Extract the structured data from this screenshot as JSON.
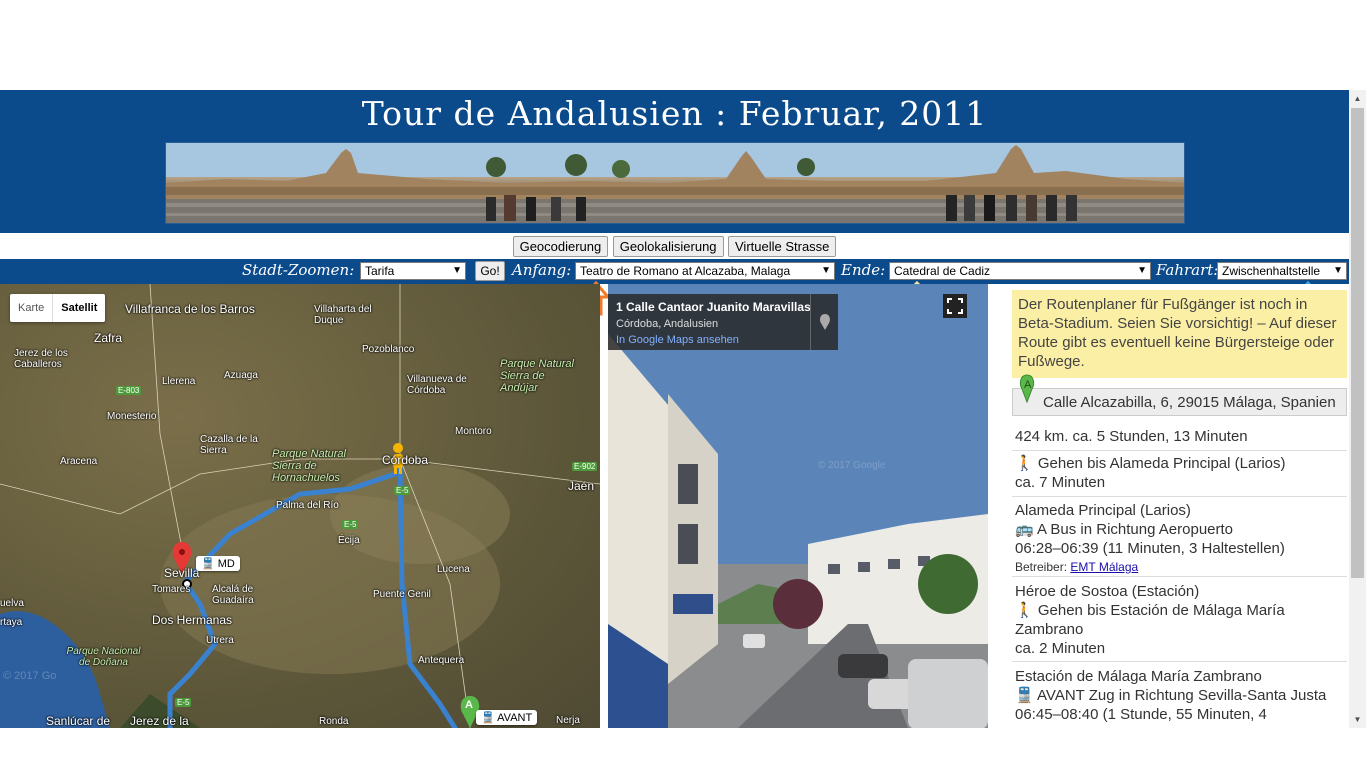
{
  "header": {
    "title": "Tour de Andalusien : Februar, 2011"
  },
  "toolbar": {
    "geocode_label": "Geocodierung",
    "geolocate_label": "Geolokalisierung",
    "virtual_street_label": "Virtuelle Strasse"
  },
  "controls": {
    "city_zoom_label": "Stadt-Zoomen:",
    "city_zoom_value": "Tarifa",
    "go_label": "Go!",
    "start_label": "Anfang:",
    "start_value": "Teatro de Romano at Alcazaba, Malaga",
    "end_label": "Ende:",
    "end_value": "Catedral de Cadiz",
    "travel_mode_label": "Fahrart:",
    "travel_mode_value": "Zwischenhaltstelle"
  },
  "map": {
    "type_map_label": "Karte",
    "type_satellite_label": "Satellit",
    "places": {
      "villafranca": "Villafranca de los Barros",
      "zafra": "Zafra",
      "jerez_caballeros": "Jerez de los Caballeros",
      "llerena": "Llerena",
      "azuaga": "Azuaga",
      "pozoblanco": "Pozoblanco",
      "villanueva": "Villanueva de Córdoba",
      "monesterio": "Monesterio",
      "cazalla": "Cazalla de la Sierra",
      "aracena": "Aracena",
      "montoro": "Montoro",
      "andujar_park": "Parque Natural Sierra de Andújar",
      "hornachuelos_park": "Parque Natural Sierra de Hornachuelos",
      "cordoba": "Córdoba",
      "jaen": "Jaén",
      "palma": "Palma del Río",
      "ecija": "Écija",
      "sevilla": "Sevilla",
      "tomares": "Tomares",
      "alcala": "Alcalá de Guadaíra",
      "dos_hermanas": "Dos Hermanas",
      "utrera": "Utrera",
      "lucena": "Lucena",
      "puente_genil": "Puente Genil",
      "antequera": "Antequera",
      "donana_park": "Parque Nacional de Doñana",
      "sanlucar": "Sanlúcar de",
      "jerez": "Jerez de la",
      "ronda": "Ronda",
      "nerja": "Nerja",
      "huelva": "uelva",
      "cartaya": "rtaya"
    },
    "roads": [
      "E-803",
      "E-5",
      "E-902",
      "E-5",
      "E-5"
    ],
    "transit_md": "MD",
    "transit_avant": "AVANT",
    "marker_a": "A",
    "watermark": "© 2017 Go"
  },
  "streetview": {
    "address": "1 Calle Cantaor Juanito Maravillas",
    "city": "Córdoba, Andalusien",
    "maps_link": "In Google Maps ansehen",
    "watermark": "© 2017 Google"
  },
  "directions": {
    "warning": "Der Routenplaner für Fußgänger ist noch in Beta-Stadium. Seien Sie vorsichtig! – Auf dieser Route gibt es eventuell keine Bürgersteige oder Fußwege.",
    "start_marker": "A",
    "start_address": "Calle Alcazabilla, 6, 29015 Málaga, Spanien",
    "summary": "424 km. ca. 5 Stunden, 13 Minuten",
    "step1_text": "Gehen bis Alameda Principal (Larios)",
    "step1_time": "ca. 7 Minuten",
    "stop1_name": "Alameda Principal (Larios)",
    "stop1_line": "A",
    "stop1_text": "Bus in Richtung Aeropuerto",
    "stop1_time": "06:28–06:39 (11 Minuten, 3 Haltestellen)",
    "operator_label": "Betreiber:",
    "operator_name": "EMT Málaga",
    "stop2_name": "Héroe de Sostoa (Estación)",
    "step2_text": "Gehen bis Estación de Málaga María Zambrano",
    "step2_time": "ca. 2 Minuten",
    "stop3_name": "Estación de Málaga María Zambrano",
    "stop3_line": "AVANT",
    "stop3_text": "Zug in Richtung Sevilla-Santa Justa",
    "stop3_time": "06:45–08:40 (1 Stunde, 55 Minuten, 4"
  }
}
